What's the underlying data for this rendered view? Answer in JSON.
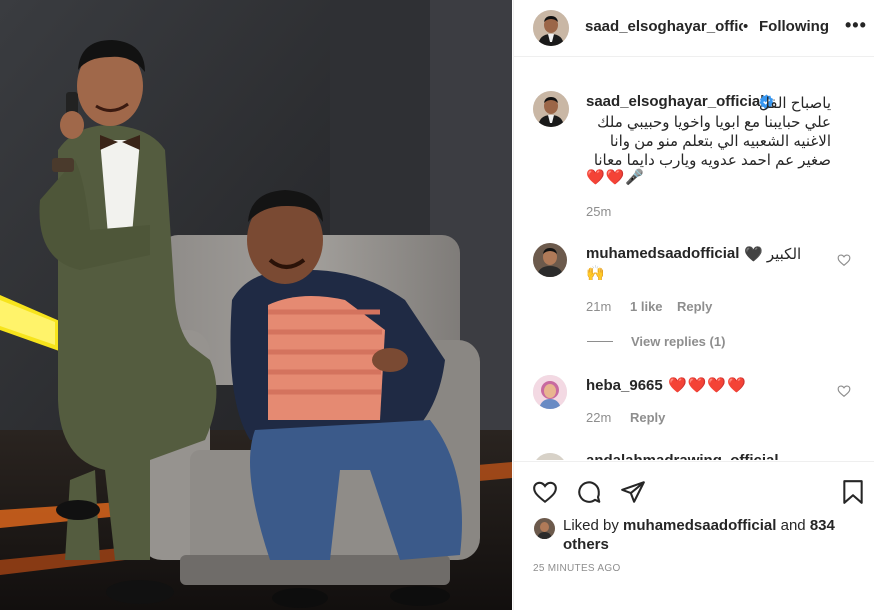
{
  "post": {
    "image_alt": "Two men on a talk-show stage seated on a grey armchair",
    "accent": "#0095f6",
    "like_red": "#ed4956"
  },
  "header": {
    "username": "saad_elsoghayar_official",
    "dot": "•",
    "follow_label": "Following",
    "more_icon": "more-dots-icon",
    "more_label": "•••"
  },
  "caption": {
    "username": "saad_elsoghayar_official",
    "verified": true,
    "lines": [
      "ياصباح الفل",
      "علي حبايبنا مع ابويا واخويا وحبيبي ملك",
      "الاغنيه الشعبيه الي بتعلم منو من وانا",
      "صغير عم احمد عدويه ويارب دايما معانا"
    ],
    "emoji": "❤️❤️🎤",
    "time": "25m"
  },
  "comments": [
    {
      "username": "muhamedsaadofficial",
      "text": "الكبير 🖤",
      "emoji_line": "🙌",
      "time": "21m",
      "likes": "1 like",
      "reply_label": "Reply",
      "view_replies": "View replies (1)"
    },
    {
      "username": "heba_9665",
      "text": "❤️❤️❤️❤️",
      "time": "22m",
      "reply_label": "Reply"
    },
    {
      "username": "andalahmadrawing_official"
    }
  ],
  "actions": {
    "like_icon": "heart-outline-icon",
    "comment_icon": "comment-bubble-icon",
    "share_icon": "paper-plane-icon",
    "save_icon": "bookmark-icon"
  },
  "likes": {
    "prefix": "Liked by ",
    "user": "muhamedsaadofficial",
    "and": " and ",
    "others": "834 others"
  },
  "timestamp": "25 MINUTES AGO"
}
